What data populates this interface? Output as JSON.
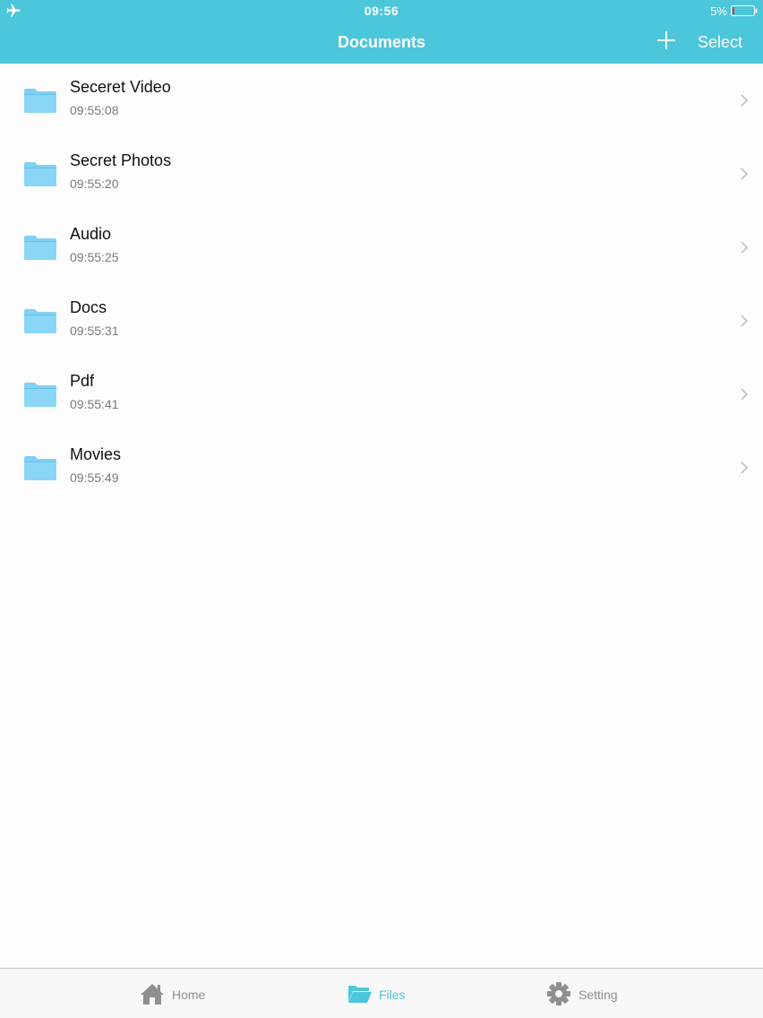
{
  "status": {
    "time": "09:56",
    "battery_percent": "5%",
    "airplane_icon": "airplane-icon",
    "battery_icon": "battery-low-icon"
  },
  "nav": {
    "title": "Documents",
    "add_icon": "plus-icon",
    "select_label": "Select"
  },
  "folders": [
    {
      "name": "Seceret Video",
      "time": "09:55:08"
    },
    {
      "name": "Secret Photos",
      "time": "09:55:20"
    },
    {
      "name": "Audio",
      "time": "09:55:25"
    },
    {
      "name": "Docs",
      "time": "09:55:31"
    },
    {
      "name": "Pdf",
      "time": "09:55:41"
    },
    {
      "name": "Movies",
      "time": "09:55:49"
    }
  ],
  "tabs": {
    "home": {
      "label": "Home",
      "icon": "home-icon"
    },
    "files": {
      "label": "Files",
      "icon": "folder-open-icon",
      "active": true
    },
    "setting": {
      "label": "Setting",
      "icon": "gear-icon"
    }
  },
  "colors": {
    "accent": "#4cc6db",
    "folder": "#7fd0f5",
    "inactive_tab": "#8e8e93"
  }
}
